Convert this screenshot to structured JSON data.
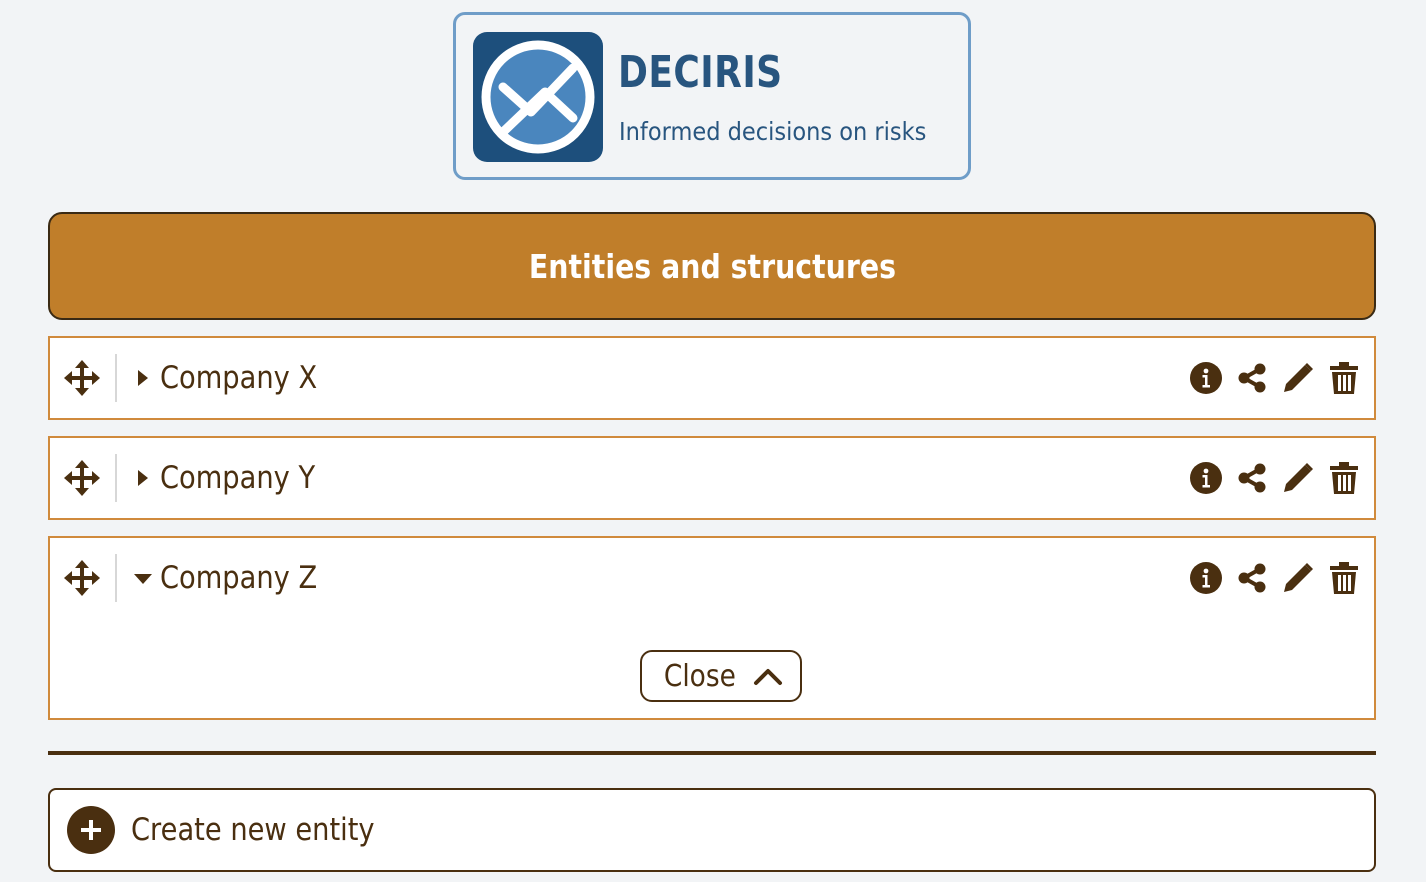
{
  "brand": {
    "name": "DECIRIS",
    "tagline": "Informed decisions on risks",
    "logo_icon": "deciris-logo-icon",
    "colors": {
      "primary": "#1d4f7c",
      "accent": "#4a86be",
      "border": "#6f9dc8"
    }
  },
  "section": {
    "title": "Entities and structures",
    "color": "#c07e2a"
  },
  "entities": [
    {
      "name": "Company X",
      "expanded": false
    },
    {
      "name": "Company Y",
      "expanded": false
    },
    {
      "name": "Company Z",
      "expanded": true,
      "close_label": "Close"
    }
  ],
  "row_actions": [
    "info-icon",
    "share-icon",
    "edit-icon",
    "trash-icon"
  ],
  "create": {
    "label": "Create new entity",
    "icon": "plus-circle-icon"
  },
  "colors": {
    "text": "#4a2f10",
    "entity_border": "#d08a3c",
    "background": "#f2f4f6"
  }
}
